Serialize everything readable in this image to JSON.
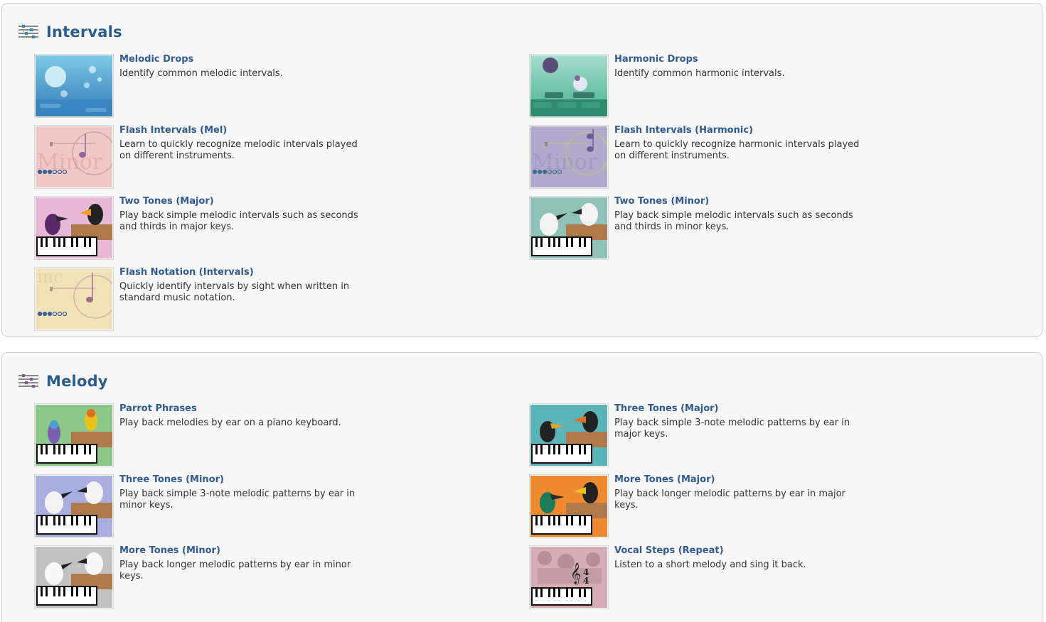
{
  "sections": [
    {
      "title": "Intervals",
      "icon": "sliders-icon",
      "icon_color": "#2a8fb8",
      "items": [
        {
          "title": "Melodic Drops",
          "desc": "Identify common melodic intervals.",
          "thumb": "drops-blue"
        },
        {
          "title": "Harmonic Drops",
          "desc": "Identify common harmonic intervals.",
          "thumb": "drops-green"
        },
        {
          "title": "Flash Intervals (Mel)",
          "desc": "Learn to quickly recognize melodic intervals played on different instruments.",
          "thumb": "flash-pink"
        },
        {
          "title": "Flash Intervals (Harmonic)",
          "desc": "Learn to quickly recognize harmonic intervals played on different instruments.",
          "thumb": "flash-purple"
        },
        {
          "title": "Two Tones (Major)",
          "desc": "Play back simple melodic intervals such as seconds and thirds in major keys.",
          "thumb": "toucans-major"
        },
        {
          "title": "Two Tones (Minor)",
          "desc": "Play back simple melodic intervals such as seconds and thirds in minor keys.",
          "thumb": "birds-minor"
        },
        {
          "title": "Flash Notation (Intervals)",
          "desc": "Quickly identify intervals by sight when written in standard music notation.",
          "thumb": "flash-yellow"
        }
      ]
    },
    {
      "title": "Melody",
      "icon": "sliders-icon",
      "icon_color": "#8a4f9a",
      "items": [
        {
          "title": "Parrot Phrases",
          "desc": "Play back melodies by ear on a piano keyboard.",
          "thumb": "parrots"
        },
        {
          "title": "Three Tones (Major)",
          "desc": "Play back simple 3-note melodic patterns by ear in major keys.",
          "thumb": "toucans-teal"
        },
        {
          "title": "Three Tones (Minor)",
          "desc": "Play back simple 3-note melodic patterns by ear in minor keys.",
          "thumb": "birds-lavender"
        },
        {
          "title": "More Tones (Major)",
          "desc": "Play back longer melodic patterns by ear in major keys.",
          "thumb": "toucans-orange"
        },
        {
          "title": "More Tones (Minor)",
          "desc": "Play back longer melodic patterns by ear in minor keys.",
          "thumb": "birds-grey"
        },
        {
          "title": "Vocal Steps (Repeat)",
          "desc": "Listen to a short melody and sing it back.",
          "thumb": "vocal"
        }
      ]
    }
  ]
}
